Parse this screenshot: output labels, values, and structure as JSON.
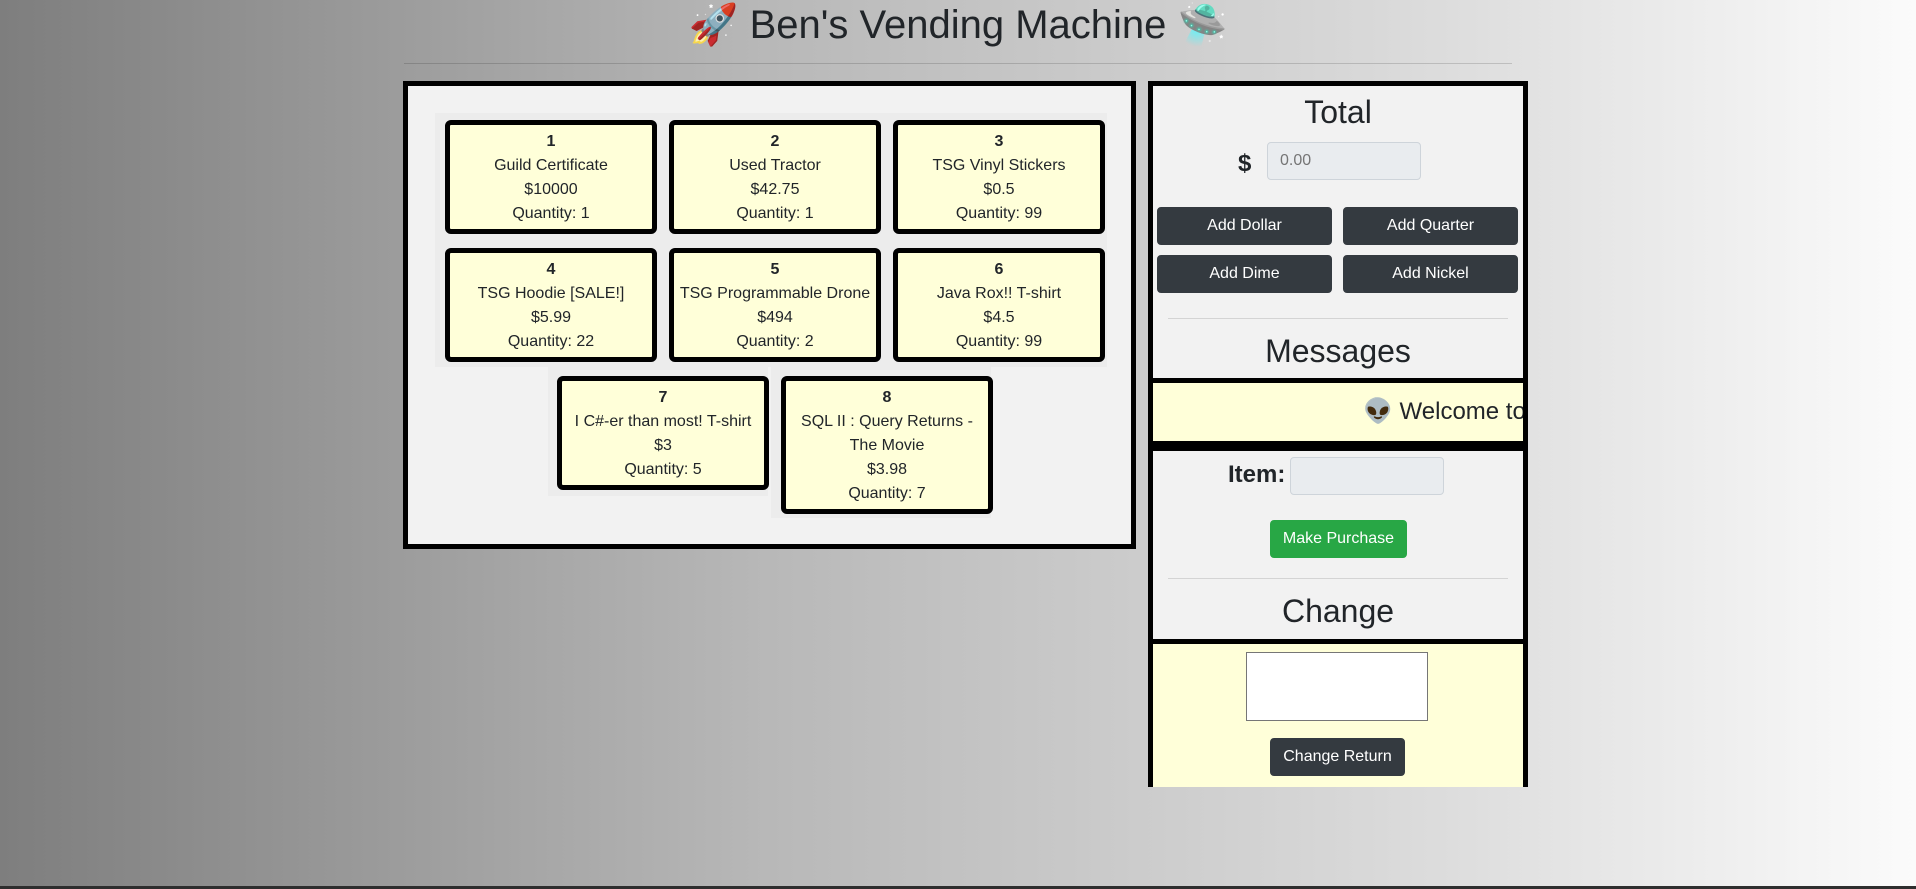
{
  "header": {
    "title": "🚀 Ben's Vending Machine 🛸"
  },
  "items": [
    {
      "number": "1",
      "name": "Guild Certificate",
      "price": "$10000",
      "quantity": "Quantity: 1"
    },
    {
      "number": "2",
      "name": "Used Tractor",
      "price": "$42.75",
      "quantity": "Quantity: 1"
    },
    {
      "number": "3",
      "name": "TSG Vinyl Stickers",
      "price": "$0.5",
      "quantity": "Quantity: 99"
    },
    {
      "number": "4",
      "name": "TSG Hoodie [SALE!]",
      "price": "$5.99",
      "quantity": "Quantity: 22"
    },
    {
      "number": "5",
      "name": "TSG Programmable Drone",
      "price": "$494",
      "quantity": "Quantity: 2"
    },
    {
      "number": "6",
      "name": "Java Rox!! T-shirt",
      "price": "$4.5",
      "quantity": "Quantity: 99"
    },
    {
      "number": "7",
      "name": "I C#-er than most! T-shirt",
      "price": "$3",
      "quantity": "Quantity: 5"
    },
    {
      "number": "8",
      "name": "SQL II : Query Returns - The Movie",
      "price": "$3.98",
      "quantity": "Quantity: 7"
    }
  ],
  "total": {
    "heading": "Total",
    "currency_symbol": "$",
    "placeholder": "0.00",
    "buttons": {
      "add_dollar": "Add Dollar",
      "add_quarter": "Add Quarter",
      "add_dime": "Add Dime",
      "add_nickel": "Add Nickel"
    }
  },
  "messages": {
    "heading": "Messages",
    "text": "👽 Welcome to"
  },
  "purchase": {
    "item_label": "Item:",
    "item_value": "",
    "button": "Make Purchase"
  },
  "change": {
    "heading": "Change",
    "value": "",
    "button": "Change Return"
  }
}
